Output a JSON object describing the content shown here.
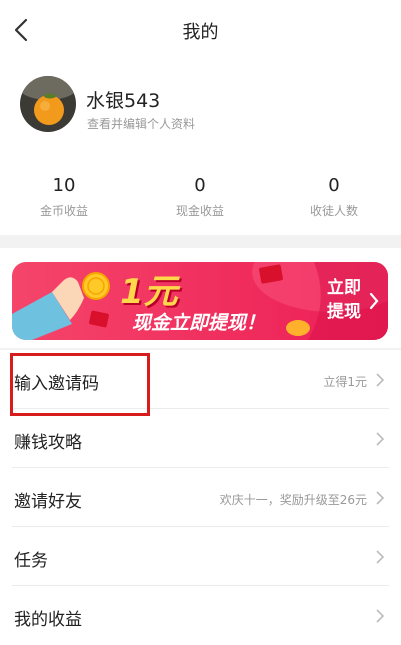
{
  "header": {
    "title": "我的"
  },
  "profile": {
    "username": "水银543",
    "edit_link": "查看并编辑个人资料"
  },
  "stats": [
    {
      "value": "10",
      "label": "金币收益"
    },
    {
      "value": "0",
      "label": "现金收益"
    },
    {
      "value": "0",
      "label": "收徒人数"
    }
  ],
  "banner": {
    "amount": "1元",
    "text": "现金立即提现！",
    "button": "立即提现",
    "accent": "#f0245a"
  },
  "menu": [
    {
      "label": "输入邀请码",
      "hint": "立得1元"
    },
    {
      "label": "赚钱攻略",
      "hint": ""
    },
    {
      "label": "邀请好友",
      "hint": "欢庆十一，奖励升级至26元"
    },
    {
      "label": "任务",
      "hint": ""
    },
    {
      "label": "我的收益",
      "hint": ""
    }
  ],
  "colors": {
    "highlight": "#d81b1b"
  }
}
